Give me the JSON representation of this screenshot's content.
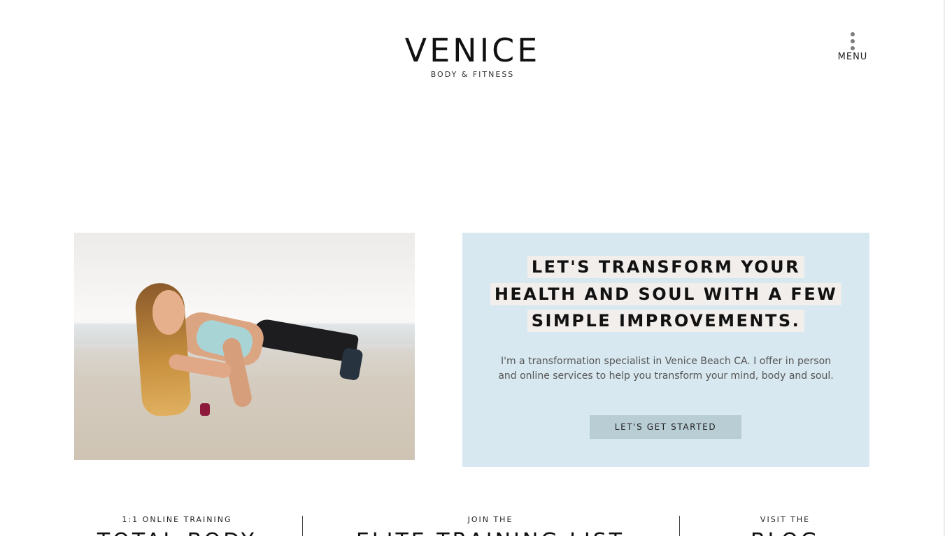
{
  "brand": {
    "title": "VENICE",
    "subtitle": "BODY & FITNESS"
  },
  "menu": {
    "icon": "more-vertical-icon",
    "label": "MENU"
  },
  "hero_image": {
    "icon": "woman-plank-beach-photo"
  },
  "intro": {
    "headline_lines": [
      "LET'S TRANSFORM YOUR",
      "HEALTH AND SOUL WITH A FEW",
      "SIMPLE IMPROVEMENTS."
    ],
    "body": "I'm a transformation specialist in Venice Beach CA. I offer in person and online services to help you transform your mind, body and soul.",
    "cta_label": "LET'S GET STARTED",
    "background": "#d7e8f0",
    "button_color": "#b9cdd5"
  },
  "features": [
    {
      "kicker": "1:1 ONLINE TRAINING",
      "title": "TOTAL BODY"
    },
    {
      "kicker": "JOIN THE",
      "title": "ELITE TRAINING LIST"
    },
    {
      "kicker": "VISIT THE",
      "title": "BLOG"
    }
  ]
}
